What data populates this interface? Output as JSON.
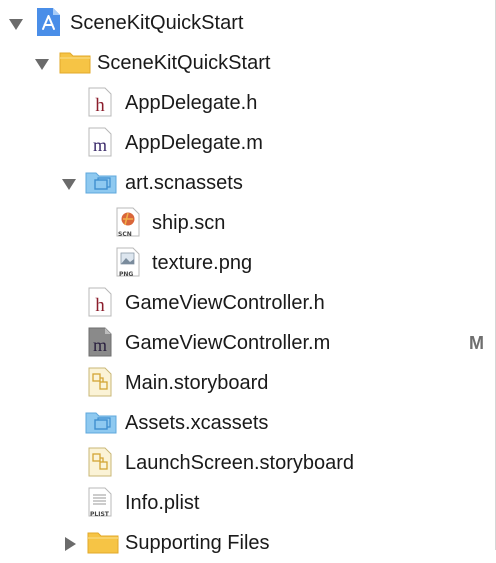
{
  "navigator": {
    "project": {
      "label": "SceneKitQuickStart",
      "icon": "xcode-project-icon"
    },
    "group": {
      "label": "SceneKitQuickStart",
      "icon": "folder-icon"
    },
    "files": [
      {
        "label": "AppDelegate.h",
        "icon": "header-file-icon"
      },
      {
        "label": "AppDelegate.m",
        "icon": "objc-source-file-icon"
      },
      {
        "label": "art.scnassets",
        "icon": "asset-folder-icon"
      },
      {
        "label": "ship.scn",
        "icon": "scn-file-icon",
        "badge_text": "SCN"
      },
      {
        "label": "texture.png",
        "icon": "png-file-icon",
        "badge_text": "PNG"
      },
      {
        "label": "GameViewController.h",
        "icon": "header-file-icon"
      },
      {
        "label": "GameViewController.m",
        "icon": "objc-source-file-icon",
        "status": "M"
      },
      {
        "label": "Main.storyboard",
        "icon": "storyboard-file-icon"
      },
      {
        "label": "Assets.xcassets",
        "icon": "asset-folder-icon"
      },
      {
        "label": "LaunchScreen.storyboard",
        "icon": "storyboard-file-icon"
      },
      {
        "label": "Info.plist",
        "icon": "plist-file-icon",
        "badge_text": "PLIST"
      },
      {
        "label": "Supporting Files",
        "icon": "folder-icon"
      }
    ]
  },
  "colors": {
    "folder_yellow": "#f6c445",
    "folder_blue": "#8ec9f0",
    "header_letter": "#8b1d2c",
    "source_letter": "#3a2a6a",
    "status_badge": "#6e6e6e",
    "disclosure": "#6b6b6b"
  }
}
